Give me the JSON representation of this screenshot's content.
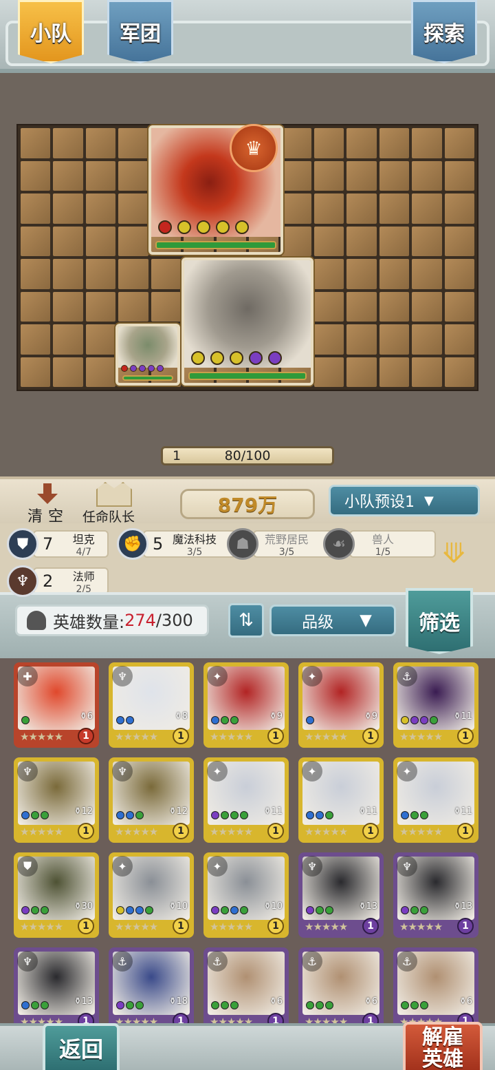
{
  "tabs": {
    "squad": "小队",
    "legion": "军团",
    "explore": "探索"
  },
  "board": {
    "level": "1",
    "progress": "80/100",
    "units": [
      {
        "name": "werewolf",
        "gems": [
          "#c4261e",
          "#d7c12a",
          "#d7c12a",
          "#d7c12a",
          "#d7c12a"
        ]
      },
      {
        "name": "golem",
        "gems": [
          "#d7c12a",
          "#d7c12a",
          "#d7c12a",
          "#7a3ec1",
          "#7a3ec1"
        ]
      },
      {
        "name": "croc",
        "gems": [
          "#c4261e",
          "#7a3ec1",
          "#7a3ec1",
          "#7a3ec1",
          "#7a3ec1"
        ]
      }
    ]
  },
  "controls": {
    "clear_label": "清空",
    "captain_label": "任命队长",
    "power": "879万",
    "preset_label": "小队预设1"
  },
  "synergies": [
    {
      "count": "7",
      "name": "坦克",
      "progress": "4/7",
      "icon": "shield-icon",
      "active": true
    },
    {
      "count": "5",
      "name": "魔法科技",
      "progress": "3/5",
      "icon": "gear-fist-icon",
      "active": true
    },
    {
      "count": "",
      "name": "荒野居民",
      "progress": "3/5",
      "icon": "wild-icon",
      "active": false
    },
    {
      "count": "",
      "name": "兽人",
      "progress": "1/5",
      "icon": "claw-icon",
      "active": false
    },
    {
      "count": "2",
      "name": "法师",
      "progress": "2/5",
      "icon": "mage-icon",
      "active": true
    }
  ],
  "heroes": {
    "count_label": "英雄数量:",
    "count_current": "274",
    "count_max": "/300",
    "sort_quality": "品级",
    "filter_label": "筛选",
    "cards": [
      {
        "rarity": "red",
        "cost": "6",
        "level": "1",
        "stars": "★★★★★",
        "gems": [
          "#3aa03a"
        ],
        "portrait": "#e0482c"
      },
      {
        "rarity": "gold",
        "cost": "8",
        "level": "1",
        "stars": "★★★★★",
        "gems": [
          "#2f6fd0",
          "#2f6fd0"
        ],
        "portrait": "#dfe3ea"
      },
      {
        "rarity": "gold",
        "cost": "9",
        "level": "1",
        "stars": "★★★★★",
        "gems": [
          "#2f6fd0",
          "#3aa03a",
          "#3aa03a"
        ],
        "portrait": "#b22424"
      },
      {
        "rarity": "gold",
        "cost": "9",
        "level": "1",
        "stars": "★★★★★",
        "gems": [
          "#2f6fd0"
        ],
        "portrait": "#b22424"
      },
      {
        "rarity": "gold",
        "cost": "11",
        "level": "1",
        "stars": "★★★★★",
        "gems": [
          "#d7c12a",
          "#7a3ec1",
          "#7a3ec1",
          "#3aa03a"
        ],
        "portrait": "#3a1c52"
      },
      {
        "rarity": "gold",
        "cost": "12",
        "level": "1",
        "stars": "★★★★★",
        "gems": [
          "#2f6fd0",
          "#3aa03a",
          "#3aa03a"
        ],
        "portrait": "#7a6a3a"
      },
      {
        "rarity": "gold",
        "cost": "12",
        "level": "1",
        "stars": "★★★★★",
        "gems": [
          "#2f6fd0",
          "#2f6fd0",
          "#3aa03a"
        ],
        "portrait": "#7a6a3a"
      },
      {
        "rarity": "gold",
        "cost": "11",
        "level": "1",
        "stars": "★★★★★",
        "gems": [
          "#7a3ec1",
          "#3aa03a",
          "#3aa03a",
          "#3aa03a"
        ],
        "portrait": "#c9ced8"
      },
      {
        "rarity": "gold",
        "cost": "11",
        "level": "1",
        "stars": "★★★★★",
        "gems": [
          "#2f6fd0",
          "#2f6fd0",
          "#3aa03a"
        ],
        "portrait": "#c9ced8"
      },
      {
        "rarity": "gold",
        "cost": "11",
        "level": "1",
        "stars": "★★★★★",
        "gems": [
          "#2f6fd0",
          "#3aa03a",
          "#3aa03a"
        ],
        "portrait": "#c9ced8"
      },
      {
        "rarity": "gold",
        "cost": "30",
        "level": "1",
        "stars": "★★★★★",
        "gems": [
          "#7a3ec1",
          "#3aa03a",
          "#3aa03a"
        ],
        "portrait": "#4e5234"
      },
      {
        "rarity": "gold",
        "cost": "10",
        "level": "1",
        "stars": "★★★★★",
        "gems": [
          "#d7c12a",
          "#2f6fd0",
          "#2f6fd0",
          "#3aa03a"
        ],
        "portrait": "#8a8f96"
      },
      {
        "rarity": "gold",
        "cost": "10",
        "level": "1",
        "stars": "★★★★★",
        "gems": [
          "#7a3ec1",
          "#3aa03a",
          "#2f6fd0",
          "#3aa03a"
        ],
        "portrait": "#8a8f96"
      },
      {
        "rarity": "purple",
        "cost": "13",
        "level": "1",
        "stars": "★★★★★",
        "gems": [
          "#7a3ec1",
          "#3aa03a",
          "#3aa03a"
        ],
        "portrait": "#2a2a2e"
      },
      {
        "rarity": "purple",
        "cost": "13",
        "level": "1",
        "stars": "★★★★★",
        "gems": [
          "#7a3ec1",
          "#3aa03a",
          "#3aa03a"
        ],
        "portrait": "#2a2a2e"
      },
      {
        "rarity": "purple",
        "cost": "13",
        "level": "1",
        "stars": "★★★★★",
        "gems": [
          "#2f6fd0",
          "#3aa03a",
          "#3aa03a"
        ],
        "portrait": "#2a2a2e"
      },
      {
        "rarity": "purple",
        "cost": "18",
        "level": "1",
        "stars": "★★★★★",
        "gems": [
          "#7a3ec1",
          "#3aa03a",
          "#3aa03a"
        ],
        "portrait": "#3a4a8a"
      },
      {
        "rarity": "purple",
        "cost": "6",
        "level": "1",
        "stars": "★★★★★",
        "gems": [
          "#3aa03a",
          "#3aa03a",
          "#3aa03a"
        ],
        "portrait": "#b09072"
      },
      {
        "rarity": "purple",
        "cost": "6",
        "level": "1",
        "stars": "★★★★★",
        "gems": [
          "#3aa03a",
          "#3aa03a",
          "#3aa03a"
        ],
        "portrait": "#b09072"
      },
      {
        "rarity": "purple",
        "cost": "6",
        "level": "1",
        "stars": "★★★★★",
        "gems": [
          "#3aa03a",
          "#3aa03a",
          "#3aa03a"
        ],
        "portrait": "#b09072"
      }
    ]
  },
  "bottom": {
    "back_label": "返回",
    "fire_label_1": "解雇",
    "fire_label_2": "英雄"
  }
}
